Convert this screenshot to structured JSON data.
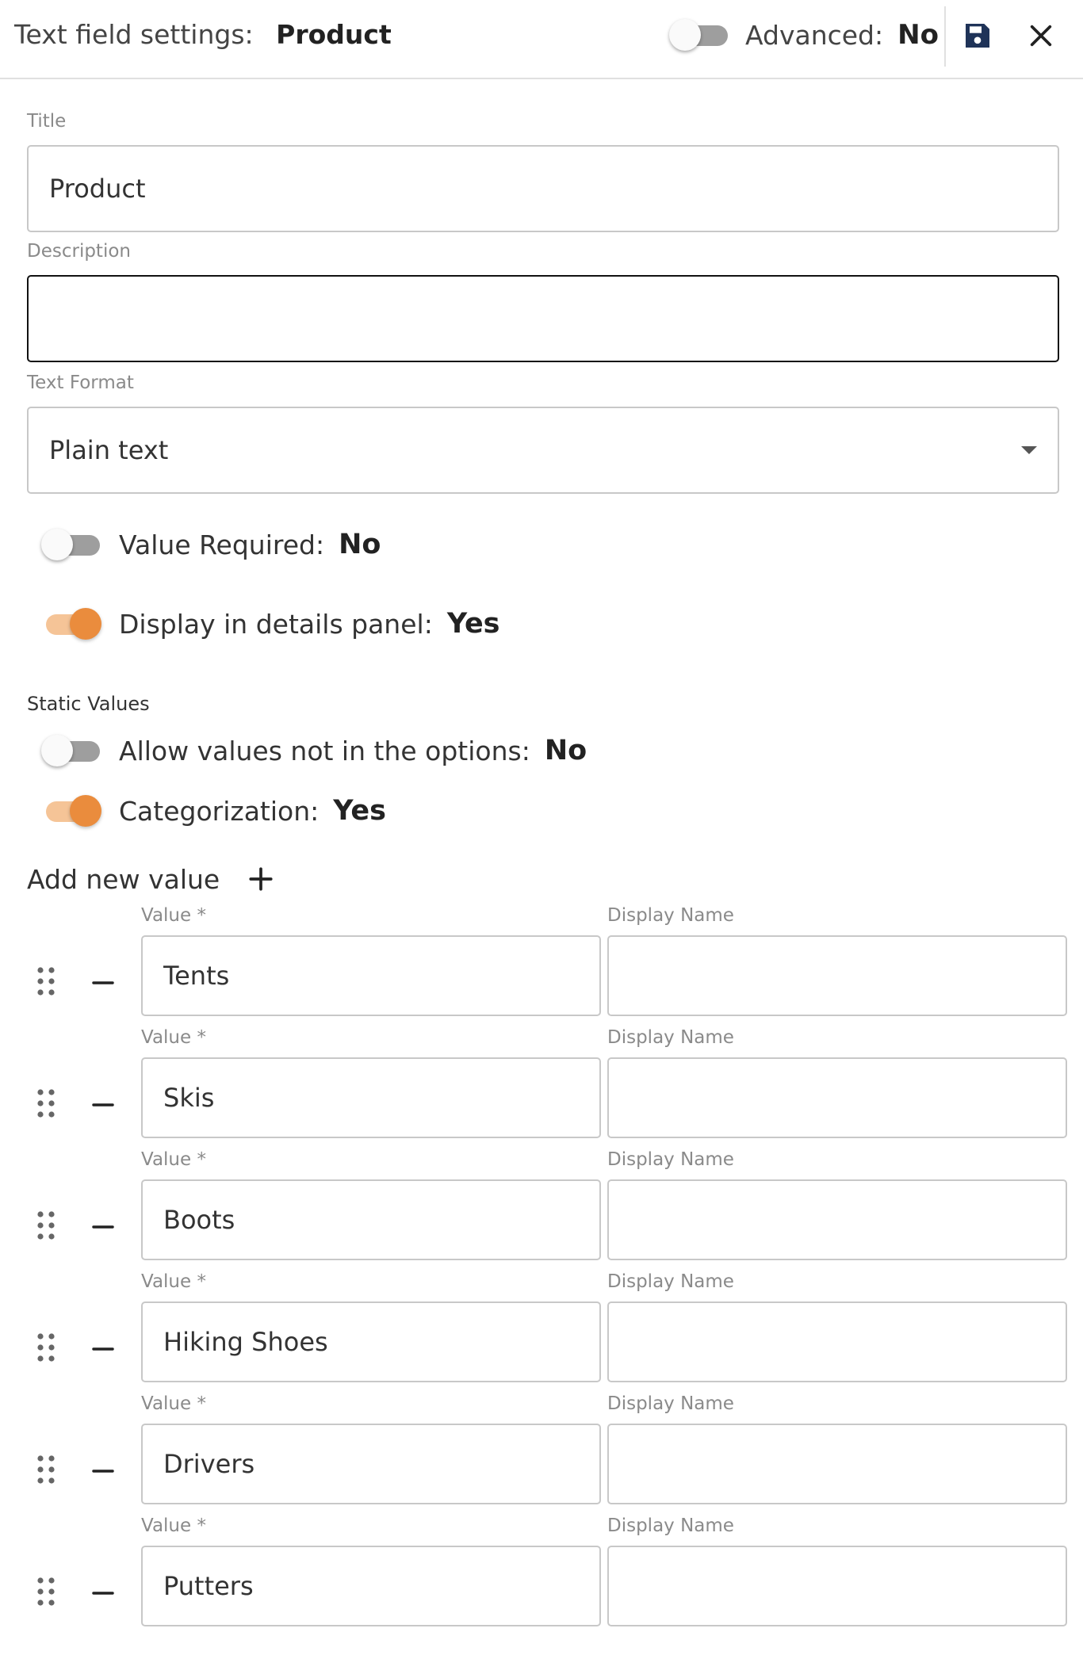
{
  "header": {
    "title_prefix": "Text field settings:",
    "field_name": "Product",
    "advanced_label": "Advanced:",
    "advanced_value": "No",
    "save_icon": "save-icon",
    "close_icon": "close-icon"
  },
  "form": {
    "title_label": "Title",
    "title_value": "Product",
    "description_label": "Description",
    "description_value": "",
    "text_format_label": "Text Format",
    "text_format_value": "Plain text",
    "value_required_label": "Value Required:",
    "value_required_value": "No",
    "display_in_details_label": "Display in details panel:",
    "display_in_details_value": "Yes"
  },
  "static_values": {
    "section_title": "Static Values",
    "allow_values_label": "Allow values not in the options:",
    "allow_values_value": "No",
    "categorization_label": "Categorization:",
    "categorization_value": "Yes",
    "add_new_value_label": "Add new value",
    "value_col_label": "Value *",
    "display_name_col_label": "Display Name",
    "rows": [
      {
        "value": "Tents",
        "display_name": ""
      },
      {
        "value": "Skis",
        "display_name": ""
      },
      {
        "value": "Boots",
        "display_name": ""
      },
      {
        "value": "Hiking Shoes",
        "display_name": ""
      },
      {
        "value": "Drivers",
        "display_name": ""
      },
      {
        "value": "Putters",
        "display_name": ""
      }
    ]
  },
  "colors": {
    "accent": "#ea8c3d",
    "accent_track": "#f5c497",
    "save_icon": "#1f3358"
  }
}
